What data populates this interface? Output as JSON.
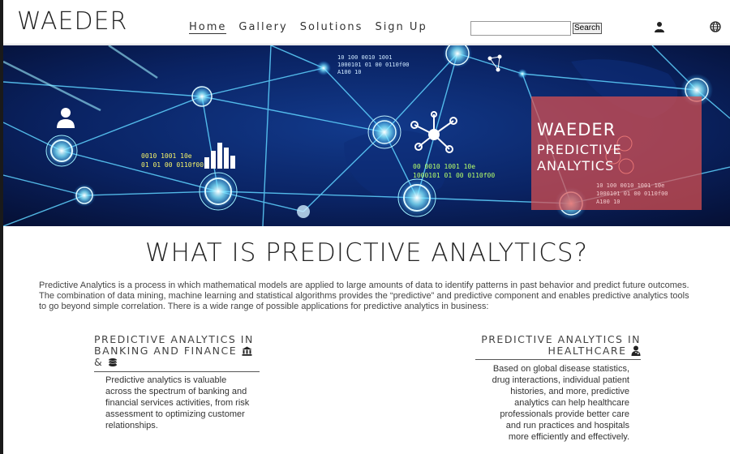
{
  "header": {
    "logo": "WAEDER",
    "nav": [
      {
        "label": "Home",
        "active": true
      },
      {
        "label": "Gallery"
      },
      {
        "label": "Solutions"
      },
      {
        "label": "Sign Up"
      }
    ],
    "search": {
      "placeholder": "",
      "button_label": "Search"
    },
    "icons": [
      "user-icon",
      "globe-icon"
    ]
  },
  "hero": {
    "title": "WAEDER",
    "subtitle": "PREDICTIVE ANALYTICS",
    "binary_left": [
      "0010  1001  10e",
      "01 01 00  0110f00"
    ],
    "binary_center": [
      "00 0010  1001  10e",
      "1000101 01 00  0110f00"
    ],
    "binary_top": [
      "10 100 0010  1001",
      "1000101 01 00  0110f00",
      "A100 10"
    ],
    "binary_box": [
      "10 100 0010  1001  10e",
      "1000101 01 00  0110f00",
      "A100 10"
    ],
    "colors": {
      "accent_green": "#b6ff6a",
      "accent_yellow": "#f5f36a",
      "box": "#dc5050"
    }
  },
  "main": {
    "heading": "WHAT IS PREDICTIVE ANALYTICS?",
    "intro": "Predictive Analytics is a process in which mathematical models are applied to large amounts of data to identify patterns in past behavior and predict future outcomes. The combination of data mining, machine learning and statistical algorithms provides the “predictive” and predictive component and enables predictive analytics tools to go beyond simple correlation. There is a wide range of possible applications for predictive analytics in business:",
    "columns": [
      {
        "title_line1": "PREDICTIVE ANALYTICS IN",
        "title_line2": "BANKING AND FINANCE",
        "title_line3": "&",
        "icons": [
          "bank-icon",
          "coins-icon"
        ],
        "body": "Predictive analytics is valuable across the spectrum of banking and financial services activities, from risk assessment to optimizing customer relationships."
      },
      {
        "title_line1": "PREDICTIVE ANALYTICS IN",
        "title_line2": "HEALTHCARE",
        "icons": [
          "doctor-icon"
        ],
        "body": "Based on global disease statistics, drug interactions, individual patient histories, and more, predictive analytics can help healthcare professionals provide better care and run practices and hospitals more efficiently and effectively."
      }
    ]
  }
}
